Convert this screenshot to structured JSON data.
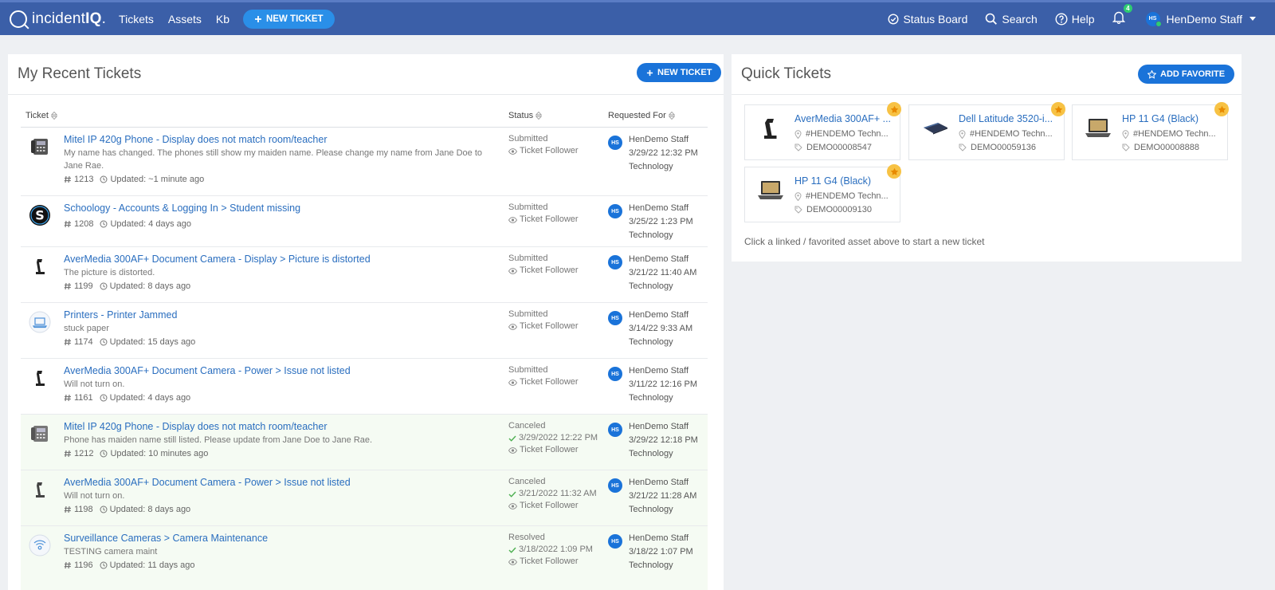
{
  "topbar": {
    "brand_left": "incident",
    "brand_right": "IQ",
    "brand_dot": ".",
    "nav": [
      "Tickets",
      "Assets",
      "Kb"
    ],
    "new_ticket": "NEW TICKET",
    "status_board": "Status Board",
    "search": "Search",
    "help": "Help",
    "notif_count": "4",
    "user_initials": "HS",
    "user_name": "HenDemo Staff"
  },
  "recent": {
    "title": "My Recent Tickets",
    "new_ticket": "NEW TICKET",
    "columns": {
      "ticket": "Ticket",
      "status": "Status",
      "requested": "Requested For"
    },
    "rows": [
      {
        "title": "Mitel IP 420g Phone - Display does not match room/teacher",
        "desc": "My name has changed. The phones still show my maiden name. Please change my name from Jane Doe to Jane Rae.",
        "num": "1213",
        "updated": "Updated: ~1 minute ago",
        "status": "Submitted",
        "status_date": "",
        "follow": "Ticket Follower",
        "req_initials": "HS",
        "req_name": "HenDemo Staff",
        "req_date": "3/29/22 12:32 PM",
        "req_dept": "Technology"
      },
      {
        "title": "Schoology - Accounts & Logging In > Student missing",
        "desc": "",
        "num": "1208",
        "updated": "Updated: 4 days ago",
        "status": "Submitted",
        "status_date": "",
        "follow": "Ticket Follower",
        "req_initials": "HS",
        "req_name": "HenDemo Staff",
        "req_date": "3/25/22 1:23 PM",
        "req_dept": "Technology"
      },
      {
        "title": "AverMedia 300AF+ Document Camera - Display > Picture is distorted",
        "desc": "The picture is distorted.",
        "num": "1199",
        "updated": "Updated: 8 days ago",
        "status": "Submitted",
        "status_date": "",
        "follow": "Ticket Follower",
        "req_initials": "HS",
        "req_name": "HenDemo Staff",
        "req_date": "3/21/22 11:40 AM",
        "req_dept": "Technology"
      },
      {
        "title": "Printers - Printer Jammed",
        "desc": "stuck paper",
        "num": "1174",
        "updated": "Updated: 15 days ago",
        "status": "Submitted",
        "status_date": "",
        "follow": "Ticket Follower",
        "req_initials": "HS",
        "req_name": "HenDemo Staff",
        "req_date": "3/14/22 9:33 AM",
        "req_dept": "Technology"
      },
      {
        "title": "AverMedia 300AF+ Document Camera - Power > Issue not listed",
        "desc": "Will not turn on.",
        "num": "1161",
        "updated": "Updated: 4 days ago",
        "status": "Submitted",
        "status_date": "",
        "follow": "Ticket Follower",
        "req_initials": "HS",
        "req_name": "HenDemo Staff",
        "req_date": "3/11/22 12:16 PM",
        "req_dept": "Technology"
      },
      {
        "title": "Mitel IP 420g Phone - Display does not match room/teacher",
        "desc": "Phone has maiden name still listed. Please update from Jane Doe to Jane Rae.",
        "num": "1212",
        "updated": "Updated: 10 minutes ago",
        "status": "Canceled",
        "status_date": "3/29/2022 12:22 PM",
        "follow": "Ticket Follower",
        "req_initials": "HS",
        "req_name": "HenDemo Staff",
        "req_date": "3/29/22 12:18 PM",
        "req_dept": "Technology"
      },
      {
        "title": "AverMedia 300AF+ Document Camera - Power > Issue not listed",
        "desc": "Will not turn on.",
        "num": "1198",
        "updated": "Updated: 8 days ago",
        "status": "Canceled",
        "status_date": "3/21/2022 11:32 AM",
        "follow": "Ticket Follower",
        "req_initials": "HS",
        "req_name": "HenDemo Staff",
        "req_date": "3/21/22 11:28 AM",
        "req_dept": "Technology"
      },
      {
        "title": "Surveillance Cameras > Camera Maintenance",
        "desc": "TESTING camera maint",
        "num": "1196",
        "updated": "Updated: 11 days ago",
        "status": "Resolved",
        "status_date": "3/18/2022 1:09 PM",
        "follow": "Ticket Follower",
        "req_initials": "HS",
        "req_name": "HenDemo Staff",
        "req_date": "3/18/22 1:07 PM",
        "req_dept": "Technology"
      }
    ]
  },
  "quick": {
    "title": "Quick Tickets",
    "add_favorite": "ADD FAVORITE",
    "cards": [
      {
        "name": "AverMedia 300AF+ ...",
        "loc": "#HENDEMO Techn...",
        "tag": "DEMO00008547",
        "icon": "document-camera-icon"
      },
      {
        "name": "Dell Latitude 3520-i...",
        "loc": "#HENDEMO Techn...",
        "tag": "DEMO00059136",
        "icon": "laptop-dark-icon"
      },
      {
        "name": "HP 11 G4 (Black)",
        "loc": "#HENDEMO Techn...",
        "tag": "DEMO00008888",
        "icon": "laptop-icon"
      },
      {
        "name": "HP 11 G4 (Black)",
        "loc": "#HENDEMO Techn...",
        "tag": "DEMO00009130",
        "icon": "laptop-icon"
      }
    ],
    "hint": "Click a linked / favorited asset above to start a new ticket"
  }
}
